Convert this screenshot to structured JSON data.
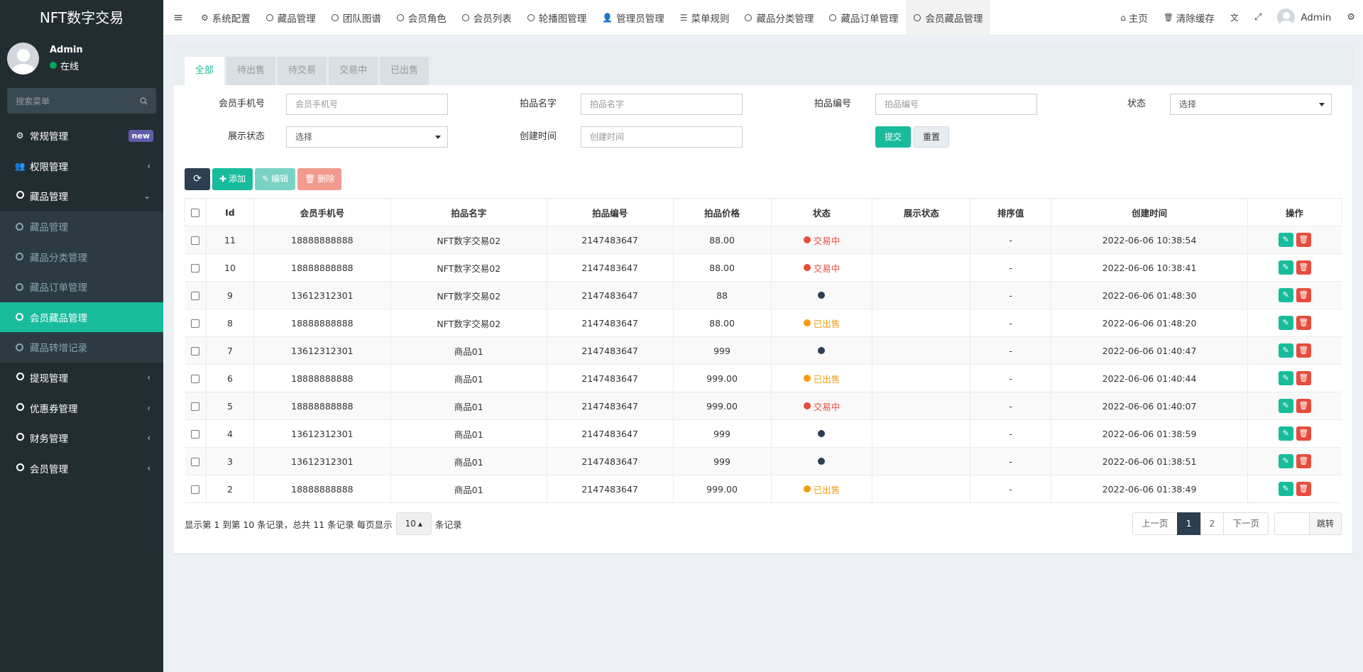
{
  "app": {
    "title": "NFT数字交易"
  },
  "user": {
    "name": "Admin",
    "status": "在线"
  },
  "sidebar": {
    "search_placeholder": "搜索菜单",
    "menu": [
      {
        "label": "常规管理",
        "icon": "cogs-icon",
        "badge": "new"
      },
      {
        "label": "权限管理",
        "icon": "users-icon"
      },
      {
        "label": "藏品管理",
        "icon": "circle-icon",
        "expanded": true
      }
    ],
    "submenu": [
      {
        "label": "藏品管理"
      },
      {
        "label": "藏品分类管理"
      },
      {
        "label": "藏品订单管理"
      },
      {
        "label": "会员藏品管理",
        "active": true
      },
      {
        "label": "藏品转增记录"
      }
    ],
    "menu_after": [
      {
        "label": "提现管理"
      },
      {
        "label": "优惠券管理"
      },
      {
        "label": "财务管理"
      },
      {
        "label": "会员管理"
      }
    ]
  },
  "topnav": {
    "tabs": [
      {
        "label": "系统配置",
        "icon": "gear-icon"
      },
      {
        "label": "藏品管理",
        "icon": "circle-icon"
      },
      {
        "label": "团队图谱",
        "icon": "circle-icon"
      },
      {
        "label": "会员角色",
        "icon": "circle-icon"
      },
      {
        "label": "会员列表",
        "icon": "circle-icon"
      },
      {
        "label": "轮播图管理",
        "icon": "circle-icon"
      },
      {
        "label": "管理员管理",
        "icon": "user-icon"
      },
      {
        "label": "菜单规则",
        "icon": "bars-icon"
      },
      {
        "label": "藏品分类管理",
        "icon": "circle-icon"
      },
      {
        "label": "藏品订单管理",
        "icon": "circle-icon"
      },
      {
        "label": "会员藏品管理",
        "icon": "circle-icon",
        "active": true
      }
    ],
    "home": "主页",
    "clear_cache": "清除缓存",
    "admin": "Admin"
  },
  "panel": {
    "tabs": [
      "全部",
      "待出售",
      "待交易",
      "交易中",
      "已出售"
    ]
  },
  "search_form": {
    "phone_label": "会员手机号",
    "phone_placeholder": "会员手机号",
    "name_label": "拍品名字",
    "name_placeholder": "拍品名字",
    "code_label": "拍品编号",
    "code_placeholder": "拍品编号",
    "status_label": "状态",
    "status_value": "选择",
    "show_label": "展示状态",
    "show_value": "选择",
    "time_label": "创建时间",
    "time_placeholder": "创建时间",
    "submit": "提交",
    "reset": "重置"
  },
  "toolbar": {
    "add": "添加",
    "edit": "编辑",
    "delete": "删除"
  },
  "table": {
    "columns": [
      "Id",
      "会员手机号",
      "拍品名字",
      "拍品编号",
      "拍品价格",
      "状态",
      "展示状态",
      "排序值",
      "创建时间",
      "操作"
    ],
    "rows": [
      {
        "id": "11",
        "phone": "18888888888",
        "name": "NFT数字交易02",
        "code": "2147483647",
        "price": "88.00",
        "status": "交易中",
        "status_type": "red",
        "show": "",
        "sort": "-",
        "time": "2022-06-06 10:38:54"
      },
      {
        "id": "10",
        "phone": "18888888888",
        "name": "NFT数字交易02",
        "code": "2147483647",
        "price": "88.00",
        "status": "交易中",
        "status_type": "red",
        "show": "",
        "sort": "-",
        "time": "2022-06-06 10:38:41"
      },
      {
        "id": "9",
        "phone": "13612312301",
        "name": "NFT数字交易02",
        "code": "2147483647",
        "price": "88",
        "status": "",
        "status_type": "navy",
        "show": "",
        "sort": "-",
        "time": "2022-06-06 01:48:30"
      },
      {
        "id": "8",
        "phone": "18888888888",
        "name": "NFT数字交易02",
        "code": "2147483647",
        "price": "88.00",
        "status": "已出售",
        "status_type": "orange",
        "show": "",
        "sort": "-",
        "time": "2022-06-06 01:48:20"
      },
      {
        "id": "7",
        "phone": "13612312301",
        "name": "商品01",
        "code": "2147483647",
        "price": "999",
        "status": "",
        "status_type": "navy",
        "show": "",
        "sort": "-",
        "time": "2022-06-06 01:40:47"
      },
      {
        "id": "6",
        "phone": "18888888888",
        "name": "商品01",
        "code": "2147483647",
        "price": "999.00",
        "status": "已出售",
        "status_type": "orange",
        "show": "",
        "sort": "-",
        "time": "2022-06-06 01:40:44"
      },
      {
        "id": "5",
        "phone": "18888888888",
        "name": "商品01",
        "code": "2147483647",
        "price": "999.00",
        "status": "交易中",
        "status_type": "red",
        "show": "",
        "sort": "-",
        "time": "2022-06-06 01:40:07"
      },
      {
        "id": "4",
        "phone": "13612312301",
        "name": "商品01",
        "code": "2147483647",
        "price": "999",
        "status": "",
        "status_type": "navy",
        "show": "",
        "sort": "-",
        "time": "2022-06-06 01:38:59"
      },
      {
        "id": "3",
        "phone": "13612312301",
        "name": "商品01",
        "code": "2147483647",
        "price": "999",
        "status": "",
        "status_type": "navy",
        "show": "",
        "sort": "-",
        "time": "2022-06-06 01:38:51"
      },
      {
        "id": "2",
        "phone": "18888888888",
        "name": "商品01",
        "code": "2147483647",
        "price": "999.00",
        "status": "已出售",
        "status_type": "orange",
        "show": "",
        "sort": "-",
        "time": "2022-06-06 01:38:49"
      }
    ]
  },
  "pagination": {
    "info_prefix": "显示第 1 到第 10 条记录，总共 11 条记录 每页显示",
    "page_size": "10",
    "info_suffix": "条记录",
    "prev": "上一页",
    "pages": [
      "1",
      "2"
    ],
    "current": "1",
    "next": "下一页",
    "jump": "跳转"
  },
  "colors": {
    "accent": "#18bc9c",
    "sidebar": "#222d32",
    "danger": "#e74c3c",
    "warning": "#f39c12",
    "dark": "#2c3e50"
  }
}
